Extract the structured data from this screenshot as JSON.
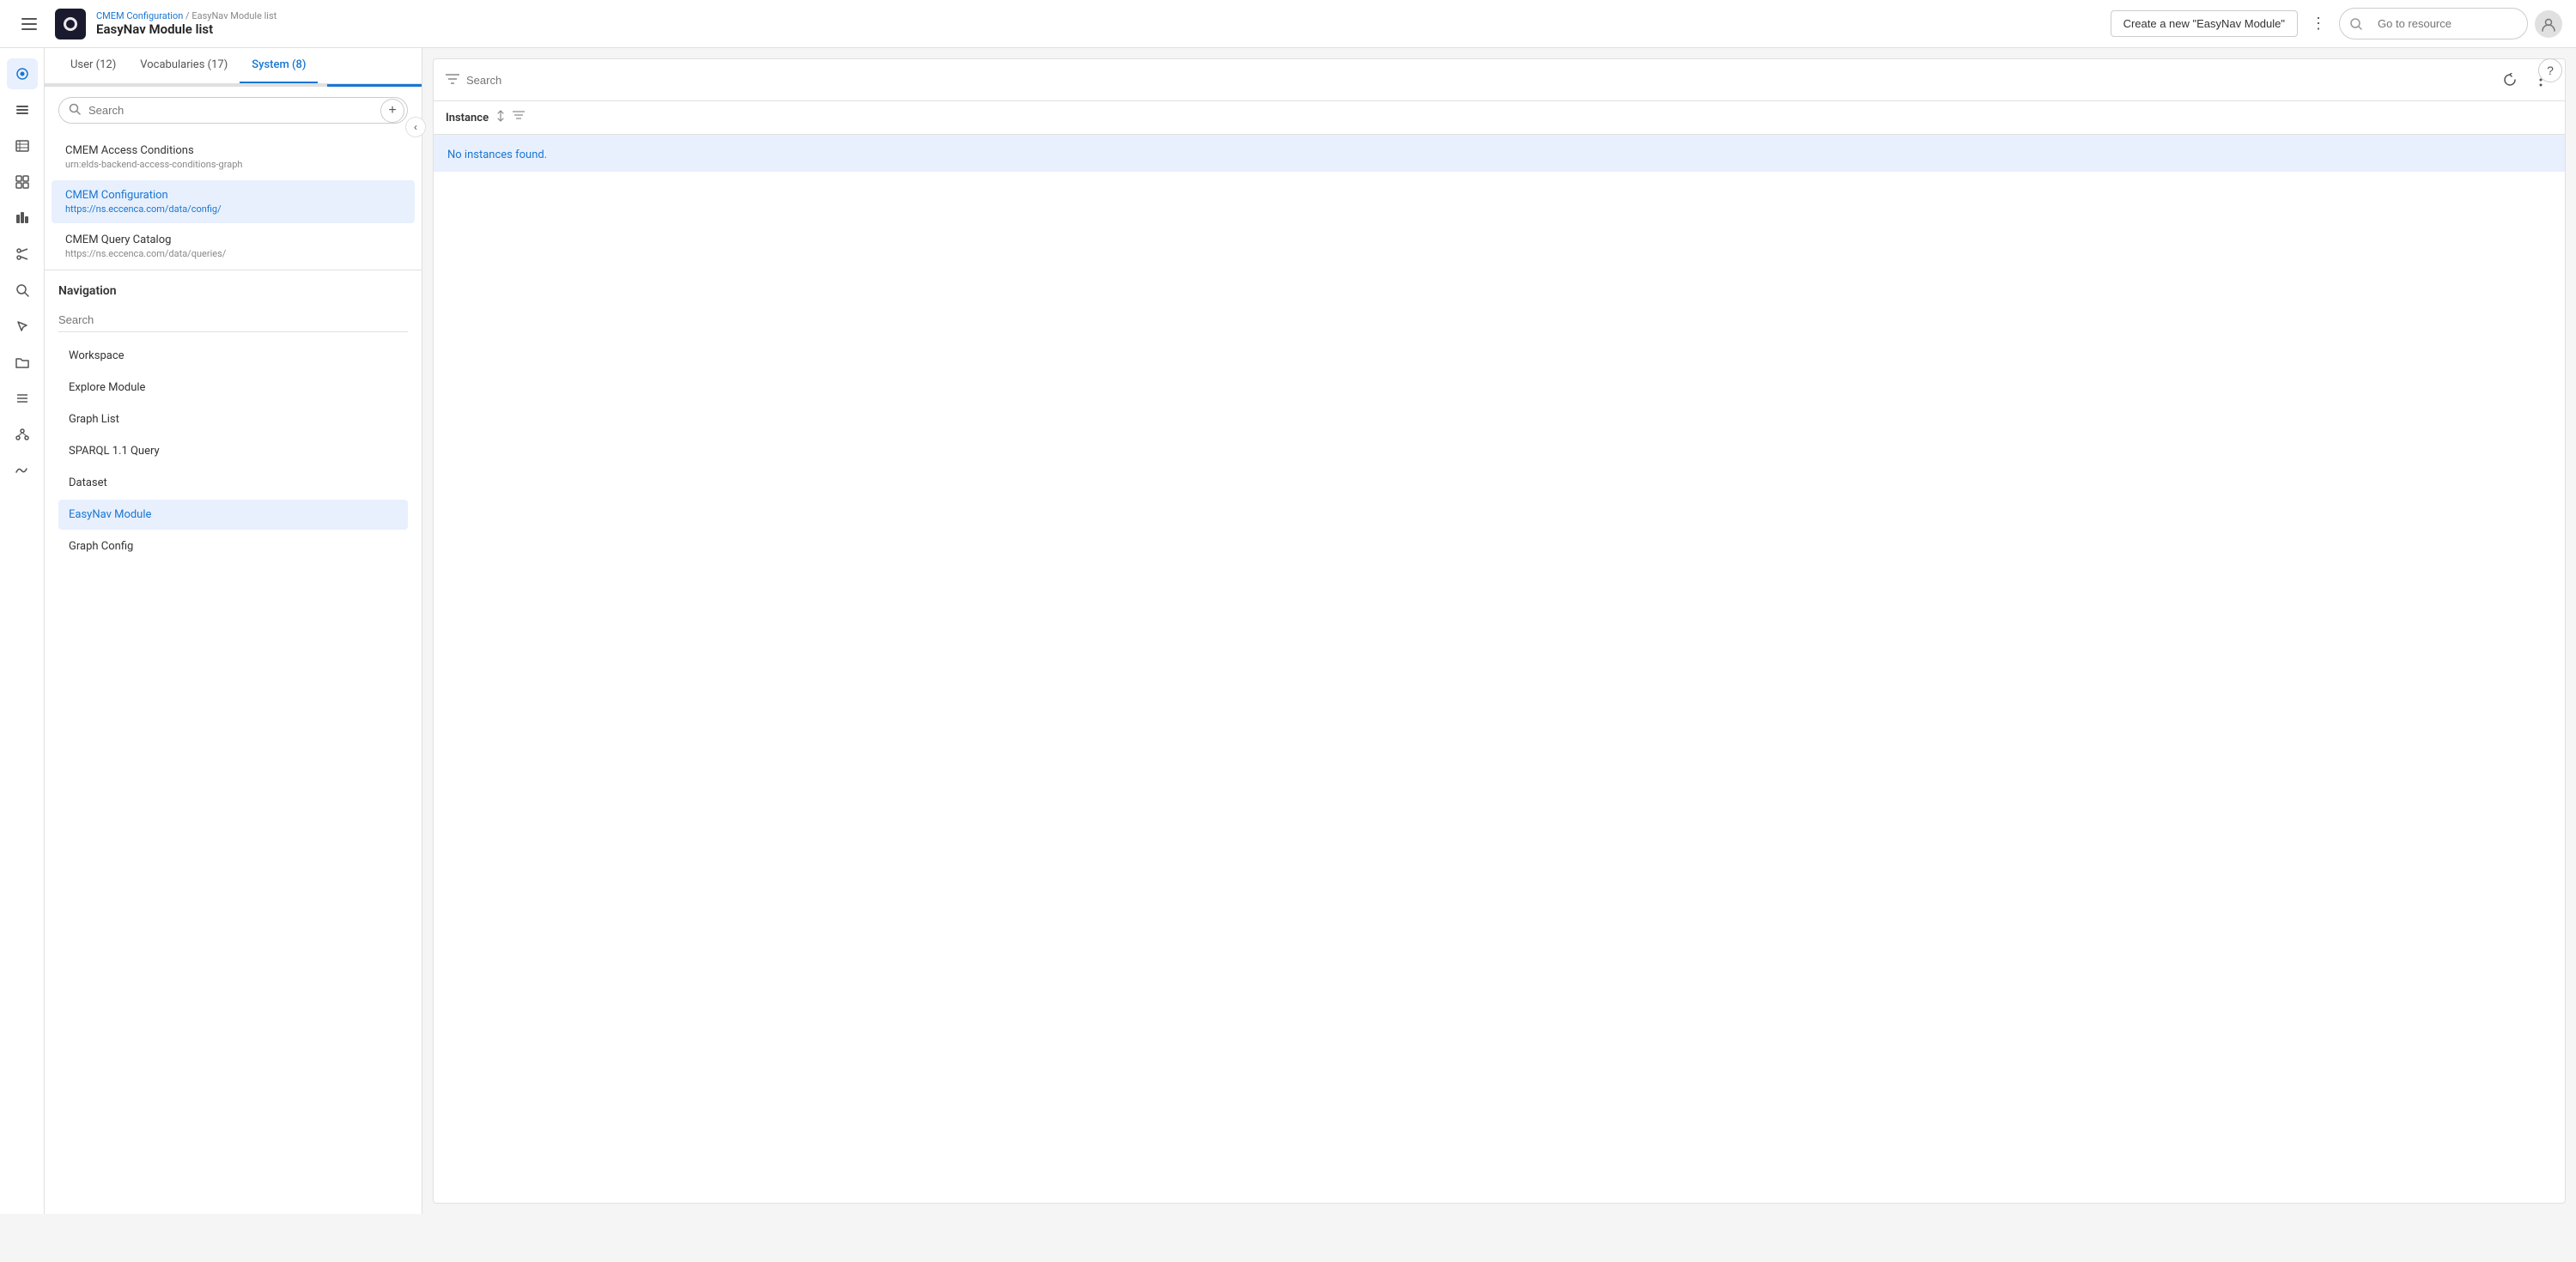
{
  "header": {
    "menu_label": "☰",
    "logo_text": "●",
    "breadcrumb_parent": "CMEM Configuration",
    "breadcrumb_separator": " / ",
    "breadcrumb_child": "EasyNav Module list",
    "page_title": "EasyNav Module list",
    "create_button_label": "Create a new \"EasyNav Module\"",
    "more_icon": "⋮",
    "search_placeholder": "Go to resource",
    "avatar_icon": "👤"
  },
  "sidebar": {
    "icons": [
      {
        "name": "home-icon",
        "symbol": "⬤",
        "active": true
      },
      {
        "name": "list-icon",
        "symbol": "☰",
        "active": false
      },
      {
        "name": "table-icon",
        "symbol": "⊟",
        "active": false
      },
      {
        "name": "chart-icon",
        "symbol": "⊞",
        "active": false
      },
      {
        "name": "analytics-icon",
        "symbol": "⊠",
        "active": false
      },
      {
        "name": "settings-icon",
        "symbol": "✂",
        "active": false
      },
      {
        "name": "search2-icon",
        "symbol": "🔍",
        "active": false
      },
      {
        "name": "pointer-icon",
        "symbol": "↖",
        "active": false
      },
      {
        "name": "folder-icon",
        "symbol": "📁",
        "active": false
      },
      {
        "name": "layers-icon",
        "symbol": "≡",
        "active": false
      },
      {
        "name": "graph-icon",
        "symbol": "⬡",
        "active": false
      },
      {
        "name": "signal-icon",
        "symbol": "∿",
        "active": false
      }
    ]
  },
  "tabs": [
    {
      "label": "User (12)",
      "active": false
    },
    {
      "label": "Vocabularies (17)",
      "active": false
    },
    {
      "label": "System (8)",
      "active": true
    }
  ],
  "list": {
    "search_placeholder": "Search",
    "items": [
      {
        "title": "CMEM Access Conditions",
        "subtitle": "urn:elds-backend-access-conditions-graph",
        "active": false
      },
      {
        "title": "CMEM Configuration",
        "subtitle": "https://ns.eccenca.com/data/config/",
        "active": true
      },
      {
        "title": "CMEM Query Catalog",
        "subtitle": "https://ns.eccenca.com/data/queries/",
        "active": false
      }
    ]
  },
  "navigation": {
    "title": "Navigation",
    "search_placeholder": "Search",
    "items": [
      {
        "label": "Workspace",
        "active": false
      },
      {
        "label": "Explore Module",
        "active": false
      },
      {
        "label": "Graph List",
        "active": false
      },
      {
        "label": "SPARQL 1.1 Query",
        "active": false
      },
      {
        "label": "Dataset",
        "active": false
      },
      {
        "label": "EasyNav Module",
        "active": true
      },
      {
        "label": "Graph Config",
        "active": false
      }
    ]
  },
  "right_panel": {
    "search_placeholder": "Search",
    "filter_icon": "⚙",
    "refresh_icon": "↺",
    "more_icon": "⋮",
    "instance_label": "Instance",
    "sort_icon": "↕",
    "filter_col_icon": "≡",
    "no_instances_text": "No instances found."
  },
  "help_icon": "?"
}
